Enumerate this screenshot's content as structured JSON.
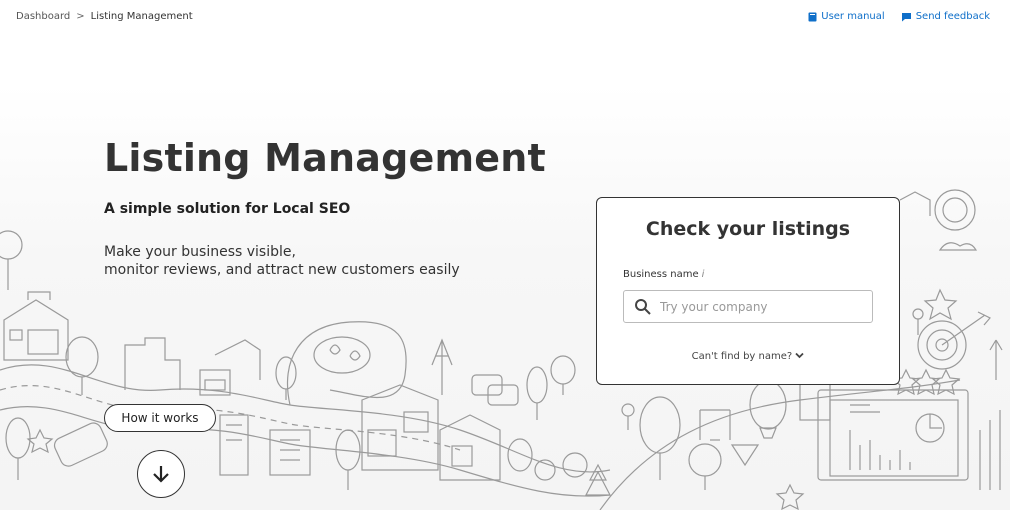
{
  "breadcrumb": {
    "items": [
      "Dashboard",
      "Listing Management"
    ],
    "separator": ">"
  },
  "toplinks": {
    "manual": "User manual",
    "feedback": "Send feedback"
  },
  "hero": {
    "title": "Listing Management",
    "subtitle": "A simple solution for Local SEO",
    "desc_line1": "Make your business visible,",
    "desc_line2": "monitor reviews, and attract new customers easily"
  },
  "card": {
    "title": "Check your listings",
    "label": "Business name",
    "info": "i",
    "placeholder": "Try your company",
    "cant_find": "Can't find by name?"
  },
  "how_it_works": "How it works",
  "colors": {
    "link": "#0f6fc9",
    "text": "#333333",
    "line": "#9a9a9a"
  }
}
